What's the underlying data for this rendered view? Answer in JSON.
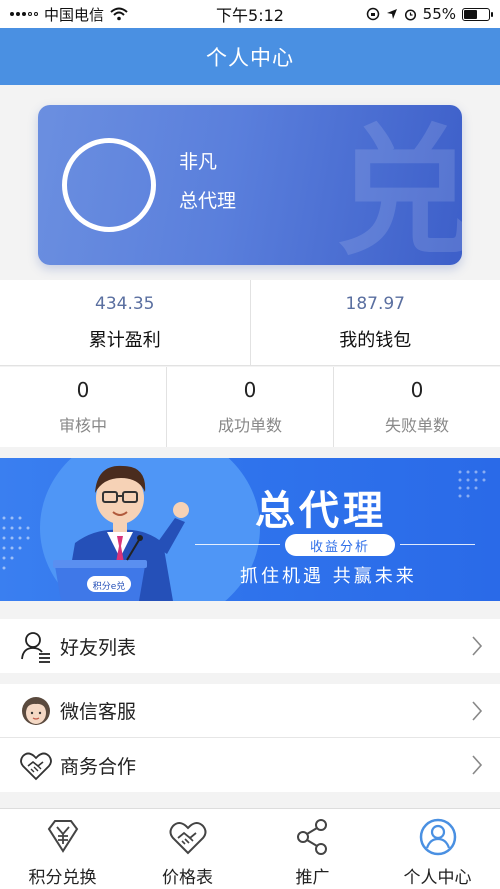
{
  "status_bar": {
    "carrier": "中国电信",
    "time": "下午5:12",
    "battery": "55%",
    "battery_level": 0.55
  },
  "header": {
    "title": "个人中心"
  },
  "profile": {
    "name": "非凡",
    "role": "总代理"
  },
  "stats_primary": [
    {
      "value": "434.35",
      "label": "累计盈利"
    },
    {
      "value": "187.97",
      "label": "我的钱包"
    }
  ],
  "stats_orders": [
    {
      "value": "0",
      "label": "审核中"
    },
    {
      "value": "0",
      "label": "成功单数"
    },
    {
      "value": "0",
      "label": "失败单数"
    }
  ],
  "banner": {
    "headline": "总代理",
    "tag": "收益分析",
    "slogan": "抓住机遇  共赢未来",
    "podium_text": "积分e兑"
  },
  "menu_group_1": [
    {
      "label": "好友列表",
      "icon": "friends-list-icon"
    }
  ],
  "menu_group_2": [
    {
      "label": "微信客服",
      "icon": "customer-service-icon"
    },
    {
      "label": "商务合作",
      "icon": "handshake-icon"
    }
  ],
  "tab_bar": [
    {
      "label": "积分兑换",
      "icon": "yen-diamond-icon"
    },
    {
      "label": "价格表",
      "icon": "handshake-icon"
    },
    {
      "label": "推广",
      "icon": "share-icon"
    },
    {
      "label": "个人中心",
      "icon": "user-icon",
      "active": true
    }
  ],
  "colors": {
    "primary": "#4a90e2",
    "card_gradient_start": "#6b8fe0",
    "card_gradient_end": "#3d5fc9",
    "banner": "#2f73ec",
    "stat_value": "#5a6fa0"
  }
}
